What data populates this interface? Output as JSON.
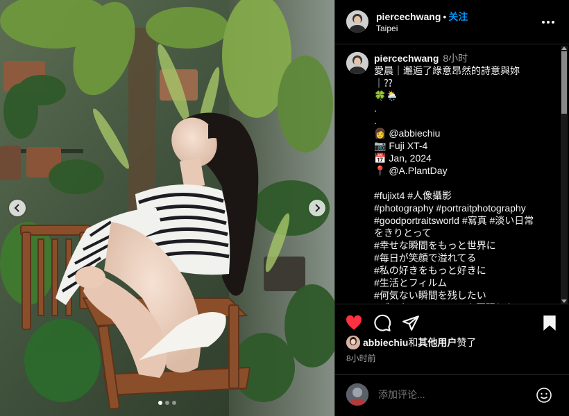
{
  "post": {
    "username": "piercechwang",
    "separator": "•",
    "follow_label": "关注",
    "location": "Taipei",
    "more_icon": "more-options-icon"
  },
  "caption": {
    "username": "piercechwang",
    "time": "8小时",
    "text": "愛晨｜邂逅了綠意昂然的詩意與妳｜⁇\n🍀🌦️\n.\n.\n👩 @abbiechiu\n📷 Fuji XT-4\n📅 Jan, 2024\n📍 @A.PlantDay\n\n#fujixt4 #人像攝影\n#photography #portraitphotography\n#goodportraitsworld #寫真 #淡い日常をきりとって\n#幸せな瞬間をもっと世界に\n#毎日が笑顔で溢れてる\n#私の好きをもっと好きに\n#生活とフィルム\n#何気ない瞬間を残したい\n#デジタルでフィルムを再現したい\n#ポートレートが好きな人と繋がりたい"
  },
  "actions": {
    "like_icon": "heart-filled-icon",
    "comment_icon": "comment-icon",
    "share_icon": "share-icon",
    "save_icon": "bookmark-filled-icon",
    "like_color": "#ff3040"
  },
  "likes": {
    "first_user": "abbiechiu",
    "connector": "和",
    "others": "其他用户",
    "suffix": "赞了"
  },
  "time_ago": "8小时前",
  "add_comment": {
    "placeholder": "添加评论...",
    "emoji_icon": "smiley-icon"
  },
  "carousel": {
    "prev_icon": "chevron-left-icon",
    "next_icon": "chevron-right-icon",
    "slide_count": 3,
    "active_slide": 1
  }
}
